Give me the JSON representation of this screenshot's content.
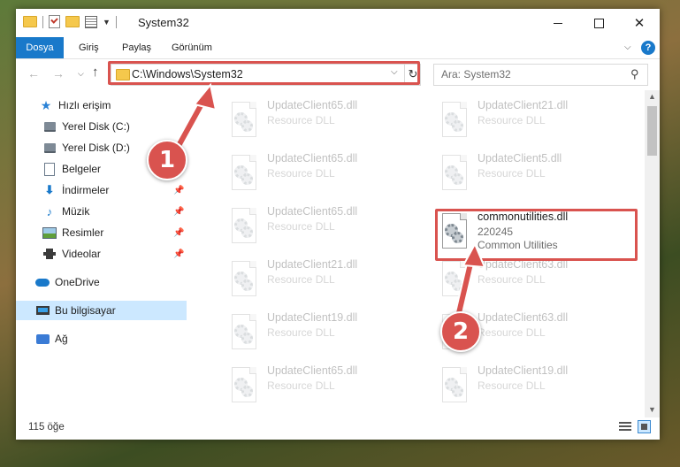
{
  "window": {
    "title": "System32",
    "controls": {
      "minimize": "",
      "maximize": "",
      "close": "✕"
    }
  },
  "ribbon": {
    "tabs": [
      "Dosya",
      "Giriş",
      "Paylaş",
      "Görünüm"
    ],
    "help": "?"
  },
  "navigation": {
    "address": "C:\\Windows\\System32",
    "search_placeholder": "Ara: System32"
  },
  "sidebar": {
    "quick_access": "Hızlı erişim",
    "items": [
      {
        "label": "Yerel Disk (C:)",
        "icon": "drive-icon",
        "pinned": false
      },
      {
        "label": "Yerel Disk (D:)",
        "icon": "drive-icon",
        "pinned": false
      },
      {
        "label": "Belgeler",
        "icon": "documents-icon",
        "pinned": true
      },
      {
        "label": "İndirmeler",
        "icon": "downloads-icon",
        "pinned": true
      },
      {
        "label": "Müzik",
        "icon": "music-icon",
        "pinned": true
      },
      {
        "label": "Resimler",
        "icon": "pictures-icon",
        "pinned": true
      },
      {
        "label": "Videolar",
        "icon": "videos-icon",
        "pinned": true
      }
    ],
    "onedrive": "OneDrive",
    "this_pc": "Bu bilgisayar",
    "network": "Ağ"
  },
  "files": [
    {
      "name": "UpdateClient65.dll",
      "type": "Resource DLL",
      "faded": true
    },
    {
      "name": "UpdateClient21.dll",
      "type": "Resource DLL",
      "faded": true
    },
    {
      "name": "UpdateClient65.dll",
      "type": "Resource DLL",
      "faded": true
    },
    {
      "name": "UpdateClient5.dll",
      "type": "Resource DLL",
      "faded": true
    },
    {
      "name": "UpdateClient65.dll",
      "type": "Resource DLL",
      "faded": true
    },
    {
      "name": "commonutilities.dll",
      "size": "220245",
      "type": "Common Utilities",
      "faded": false
    },
    {
      "name": "UpdateClient21.dll",
      "type": "Resource DLL",
      "faded": true
    },
    {
      "name": "UpdateClient63.dll",
      "type": "Resource DLL",
      "faded": true
    },
    {
      "name": "UpdateClient19.dll",
      "type": "Resource DLL",
      "faded": true
    },
    {
      "name": "UpdateClient63.dll",
      "type": "Resource DLL",
      "faded": true
    },
    {
      "name": "UpdateClient65.dll",
      "type": "Resource DLL",
      "faded": true
    },
    {
      "name": "UpdateClient19.dll",
      "type": "Resource DLL",
      "faded": true
    }
  ],
  "status": {
    "count": "115 öğe"
  },
  "callouts": {
    "one": "1",
    "two": "2"
  },
  "colors": {
    "accent": "#1979ca",
    "annotation": "#d9534f"
  }
}
